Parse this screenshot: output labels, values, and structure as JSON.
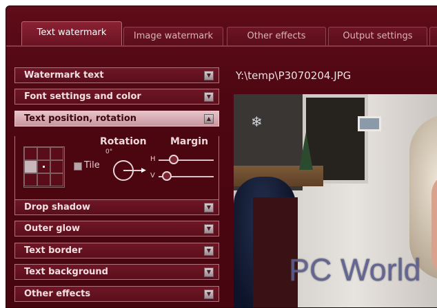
{
  "tabs": [
    {
      "label": "Text watermark",
      "active": true
    },
    {
      "label": "Image watermark",
      "active": false
    },
    {
      "label": "Other effects",
      "active": false
    },
    {
      "label": "Output settings",
      "active": false
    }
  ],
  "accordion": {
    "watermark_text": "Watermark text",
    "font_settings": "Font settings and color",
    "text_position": "Text position, rotation",
    "drop_shadow": "Drop shadow",
    "outer_glow": "Outer glow",
    "text_border": "Text border",
    "text_background": "Text background",
    "other_effects": "Other effects"
  },
  "position_panel": {
    "tile_label": "Tile",
    "rotation_title": "Rotation",
    "rotation_value": "0°",
    "margin_title": "Margin",
    "h_label": "H",
    "v_label": "V"
  },
  "preview": {
    "file_path": "Y:\\temp\\P3070204.JPG",
    "watermark_text": "PC World"
  },
  "icons": {
    "collapse": "chevron-up-icon",
    "expand": "chevron-down-icon"
  },
  "colors": {
    "background": "#4e0712",
    "accent": "#8a2233",
    "open_header": "#e7c3c9",
    "watermark": "#5a5c8e"
  }
}
